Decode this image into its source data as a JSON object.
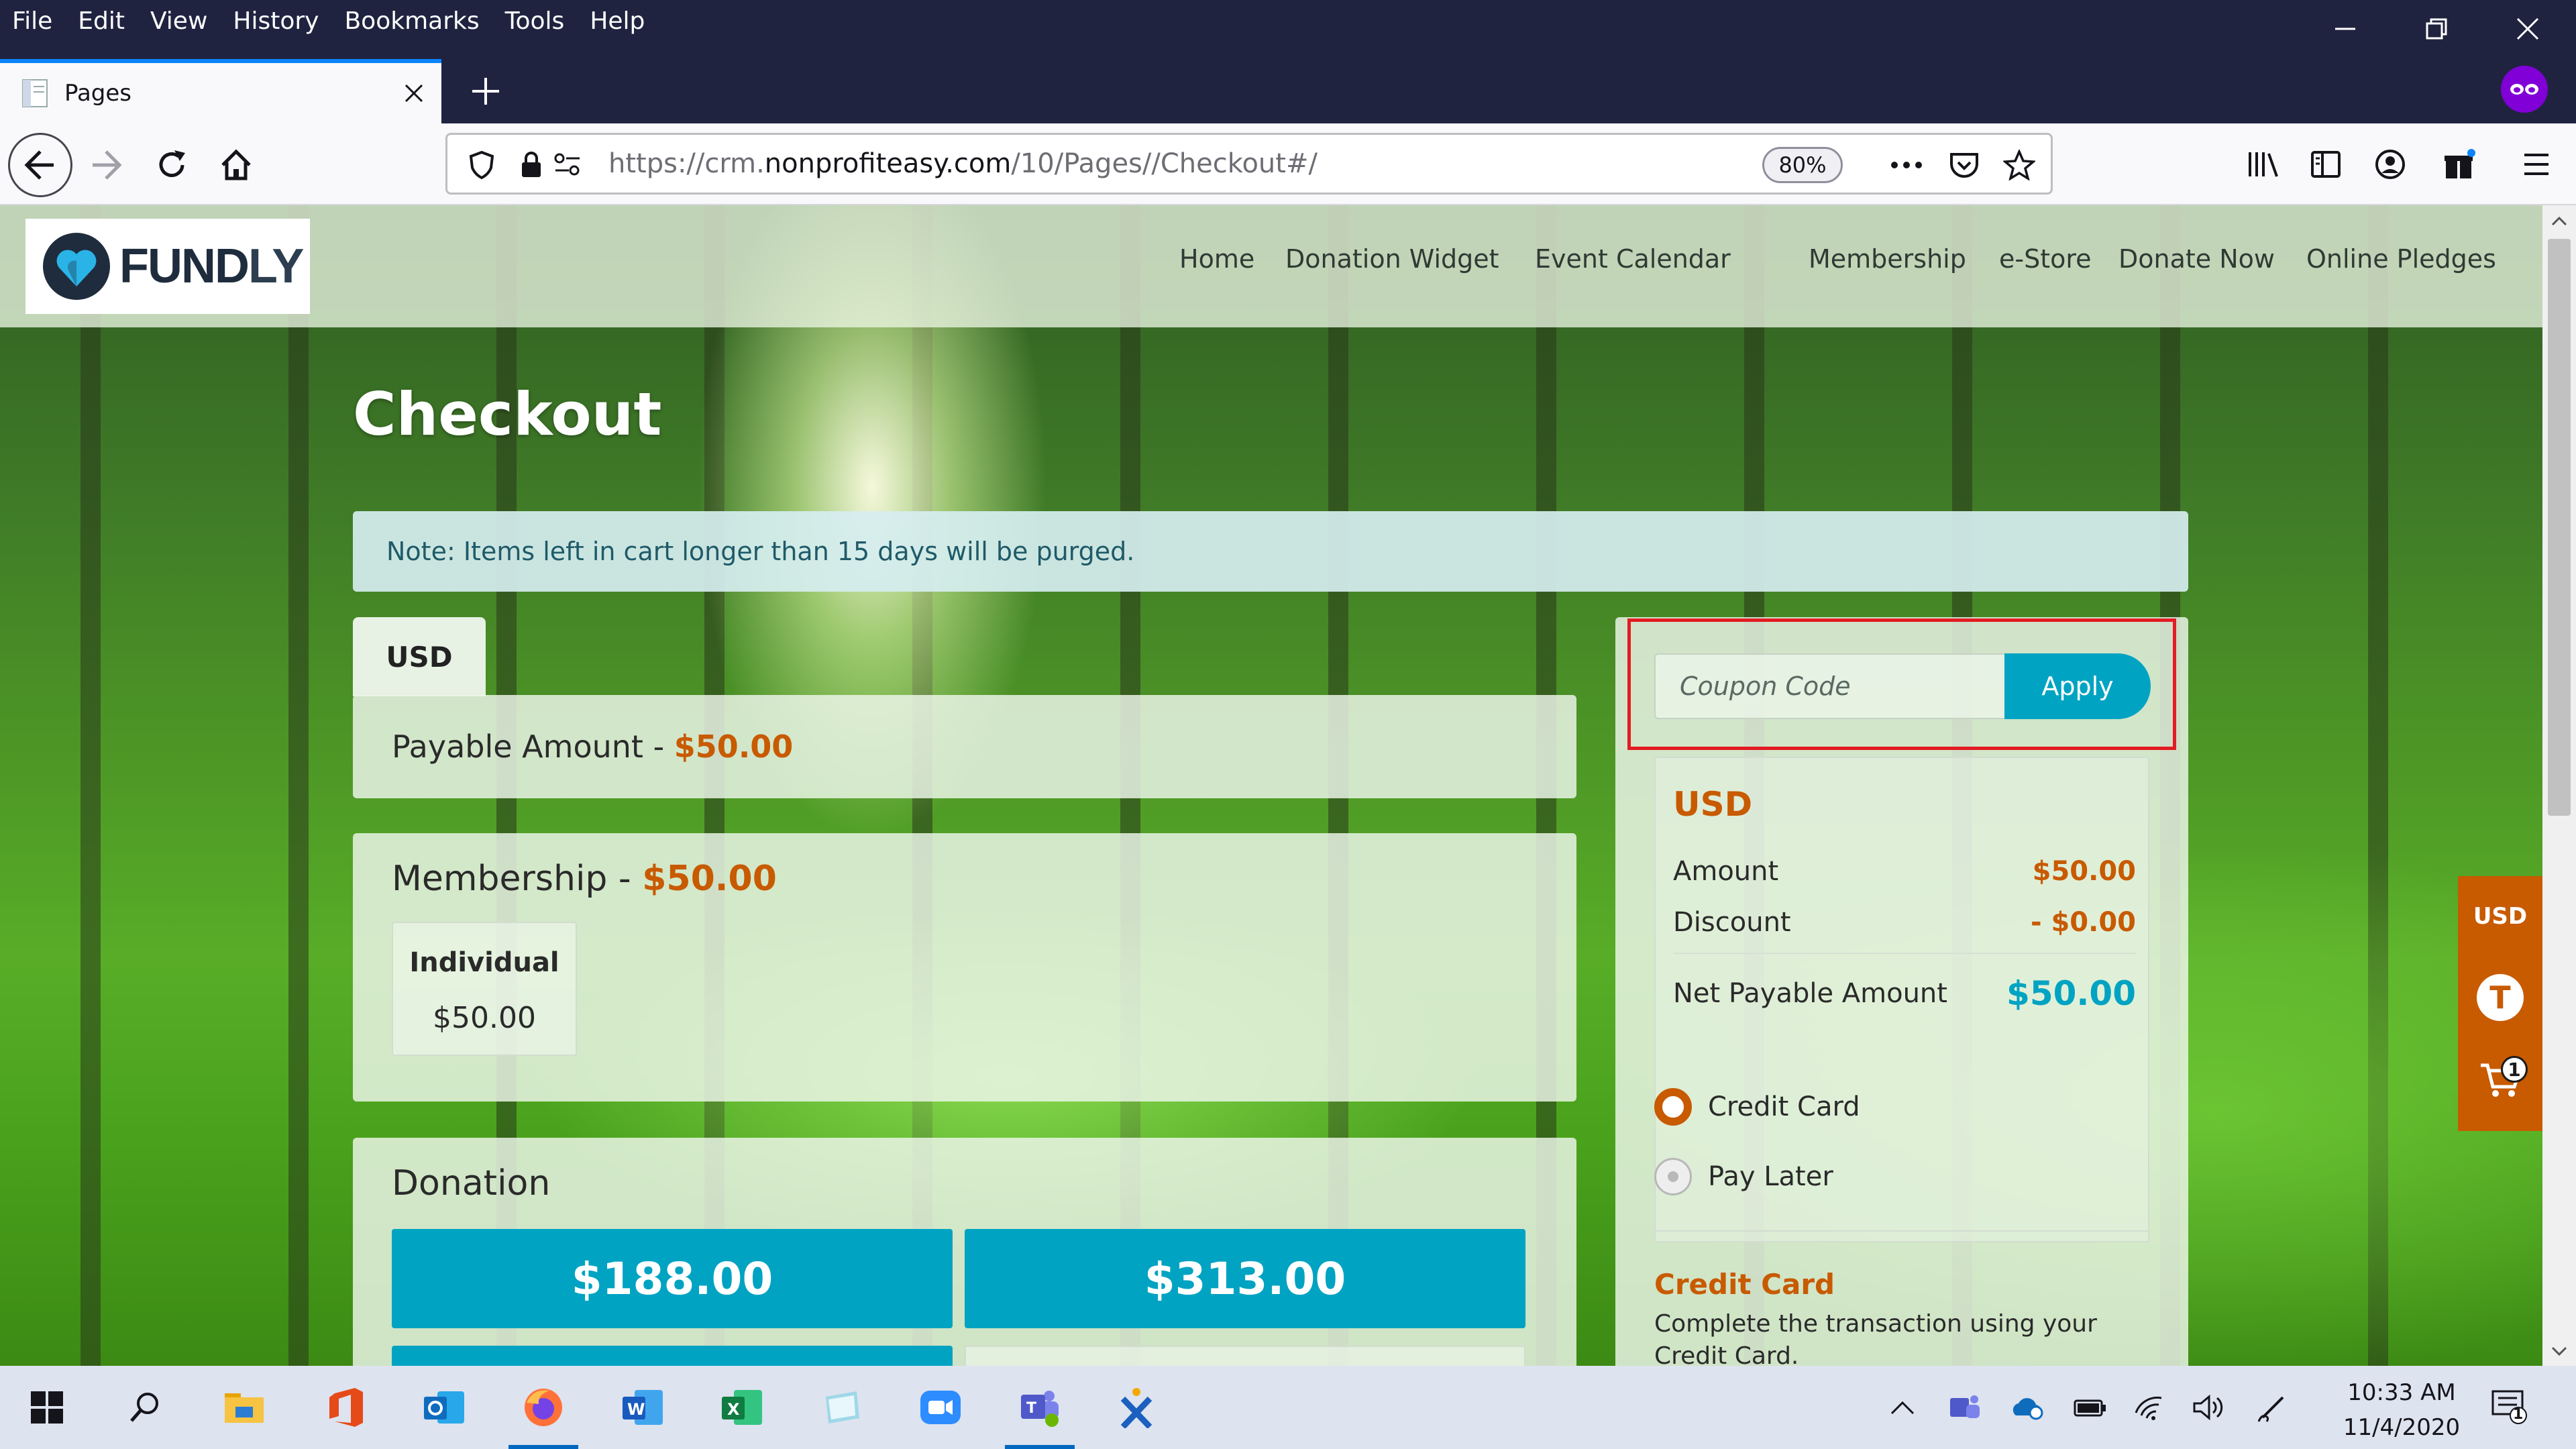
{
  "browser": {
    "menu": [
      "File",
      "Edit",
      "View",
      "History",
      "Bookmarks",
      "Tools",
      "Help"
    ],
    "tab_title": "Pages",
    "url_prefix": "https://crm.",
    "url_domain": "nonprofiteasy.com",
    "url_path": "/10/Pages//Checkout#/",
    "zoom": "80%"
  },
  "site": {
    "logo_text_a": "FUND",
    "logo_text_b": "LY",
    "nav": [
      "Home",
      "Donation Widget",
      "Event Calendar",
      "Membership",
      "e-Store",
      "Donate Now",
      "Online Pledges"
    ]
  },
  "checkout": {
    "title": "Checkout",
    "note": "Note: Items left in cart longer than 15 days will be purged.",
    "currency_tab": "USD",
    "payable_label": "Payable Amount - ",
    "payable_value": "$50.00",
    "membership_label": "Membership - ",
    "membership_value": "$50.00",
    "membership_type": "Individual",
    "membership_price": "$50.00",
    "donation_title": "Donation",
    "donation_amounts": [
      "$188.00",
      "$313.00"
    ]
  },
  "summary": {
    "coupon_placeholder": "Coupon Code",
    "apply_label": "Apply",
    "currency": "USD",
    "amount_label": "Amount",
    "amount_value": "$50.00",
    "discount_label": "Discount",
    "discount_value": "- $0.00",
    "net_label": "Net Payable Amount",
    "net_value": "$50.00",
    "payment_options": [
      "Credit Card",
      "Pay Later"
    ],
    "selected_payment": "Credit Card",
    "cc_heading": "Credit Card",
    "cc_description": "Complete the transaction using your Credit Card."
  },
  "side_bar": {
    "currency": "USD",
    "avatar_letter": "T",
    "cart_count": "1"
  },
  "taskbar": {
    "time": "10:33 AM",
    "date": "11/4/2020",
    "notification_count": "1"
  },
  "colors": {
    "accent_orange": "#c85a00",
    "accent_teal": "#00a3c2",
    "highlight_red": "#e31b23",
    "titlebar": "#202340"
  }
}
